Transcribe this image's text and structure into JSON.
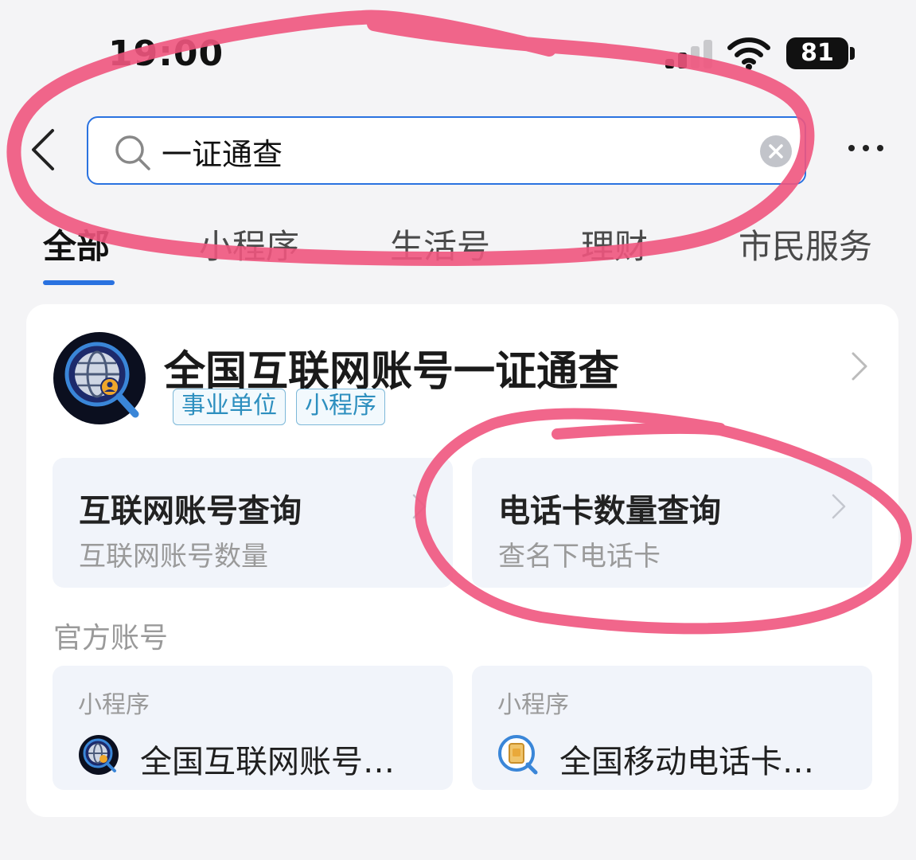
{
  "status_bar": {
    "time": "19:00",
    "battery": "81"
  },
  "search": {
    "value": "一证通查"
  },
  "tabs": [
    {
      "label": "全部"
    },
    {
      "label": "小程序"
    },
    {
      "label": "生活号"
    },
    {
      "label": "理财"
    },
    {
      "label": "市民服务"
    }
  ],
  "result": {
    "title": "全国互联网账号一证通查",
    "tags": [
      "事业单位",
      "小程序"
    ],
    "services": [
      {
        "title": "互联网账号查询",
        "desc": "互联网账号数量"
      },
      {
        "title": "电话卡数量查询",
        "desc": "查名下电话卡"
      }
    ],
    "section_label": "官方账号",
    "mini_programs": [
      {
        "type": "小程序",
        "name": "全国互联网账号…"
      },
      {
        "type": "小程序",
        "name": "全国移动电话卡…"
      }
    ]
  },
  "colors": {
    "accent": "#2a72e0",
    "annotation": "#f0557e",
    "tag_text": "#2d8fbf"
  }
}
